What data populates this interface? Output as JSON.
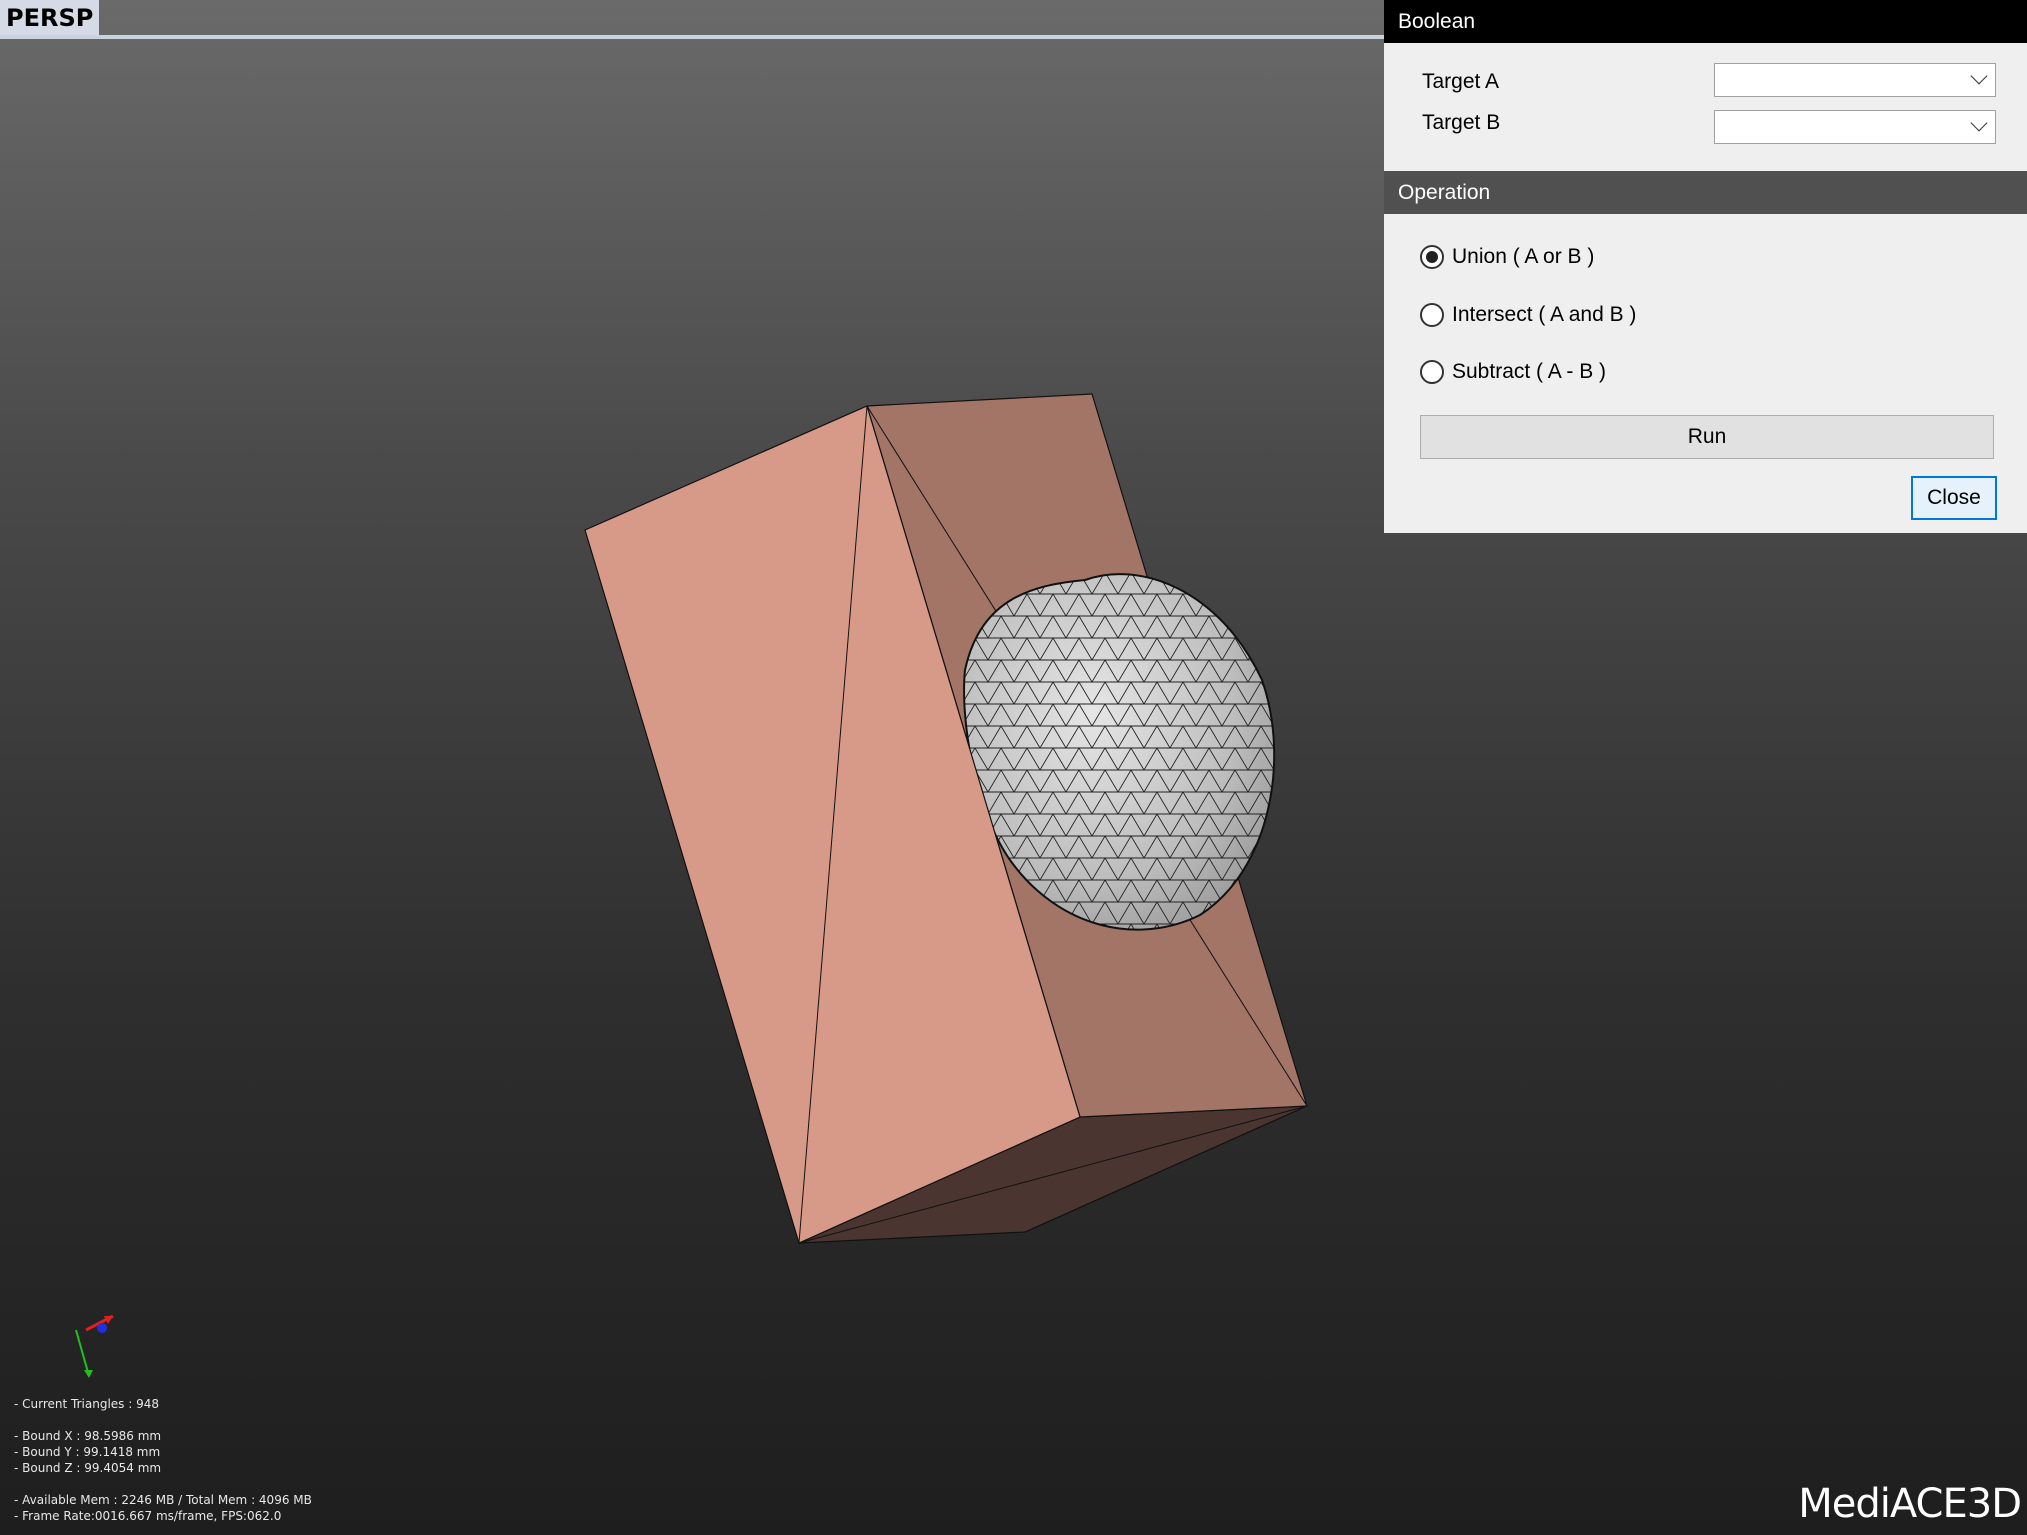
{
  "viewport": {
    "view_label": "PERSP",
    "stats": {
      "triangles": "- Current Triangles : 948",
      "bound_x": "- Bound X : 98.5986 mm",
      "bound_y": "- Bound Y : 99.1418 mm",
      "bound_z": "- Bound Z : 99.4054 mm",
      "memory": "- Available Mem : 2246 MB / Total Mem : 4096 MB",
      "frame_rate": "- Frame Rate:0016.667 ms/frame, FPS:062.0"
    },
    "logo": "MediACE3D",
    "colors": {
      "box_front": "#d89a88",
      "box_side": "#a27567",
      "box_bottom": "#4a3530",
      "sphere": "#c8c8c8"
    }
  },
  "boolean_panel": {
    "title": "Boolean",
    "target_a_label": "Target A",
    "target_a_value": "",
    "target_b_label": "Target B",
    "target_b_value": "",
    "operation_header": "Operation",
    "operations": [
      {
        "label": "Union ( A or B )",
        "selected": true
      },
      {
        "label": "Intersect ( A and B )",
        "selected": false
      },
      {
        "label": "Subtract ( A - B )",
        "selected": false
      }
    ],
    "run_label": "Run",
    "close_label": "Close"
  }
}
